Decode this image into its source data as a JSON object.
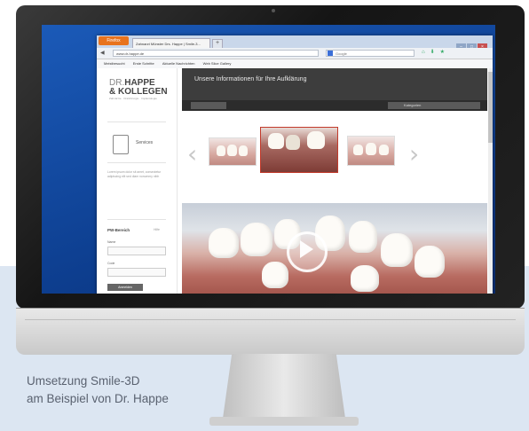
{
  "caption": {
    "line1": "Umsetzung Smile-3D",
    "line2": "am Beispiel von Dr. Happe"
  },
  "browser": {
    "app_button": "Firefox",
    "tab_title": "Zahnarzt Münster Drs. Happe | Smile-3...",
    "new_tab": "+",
    "url": "www.dr-happe.de",
    "search_placeholder": "Google",
    "bookmarks": [
      "Meistbesucht",
      "Erste Schritte",
      "Aktuelle Nachrichten",
      "Web Slice Gallery"
    ],
    "window_controls": [
      "–",
      "□",
      "×"
    ]
  },
  "site": {
    "logo_dr": "DR.",
    "logo_name": "HAPPE",
    "logo_line2": "& KOLLEGEN",
    "logo_sub": "Zahnärzte · Oralchirurgie · Implantologie",
    "sidebar_doc_label": "Services",
    "sidebar_text": "Lorem ipsum dolor sit amet, consectetur adipiscing elit sed diam nonummy nibh",
    "password_title": "PW-Bereich",
    "password_link": "Hilfe",
    "label_user": "Name",
    "label_pass": "Code",
    "login_button": "Anmelden",
    "header_title": "Unsere Informationen für Ihre Aufklärung",
    "dropdown_label": "Kategorien",
    "gallery_prev": "‹",
    "gallery_next": "›"
  }
}
